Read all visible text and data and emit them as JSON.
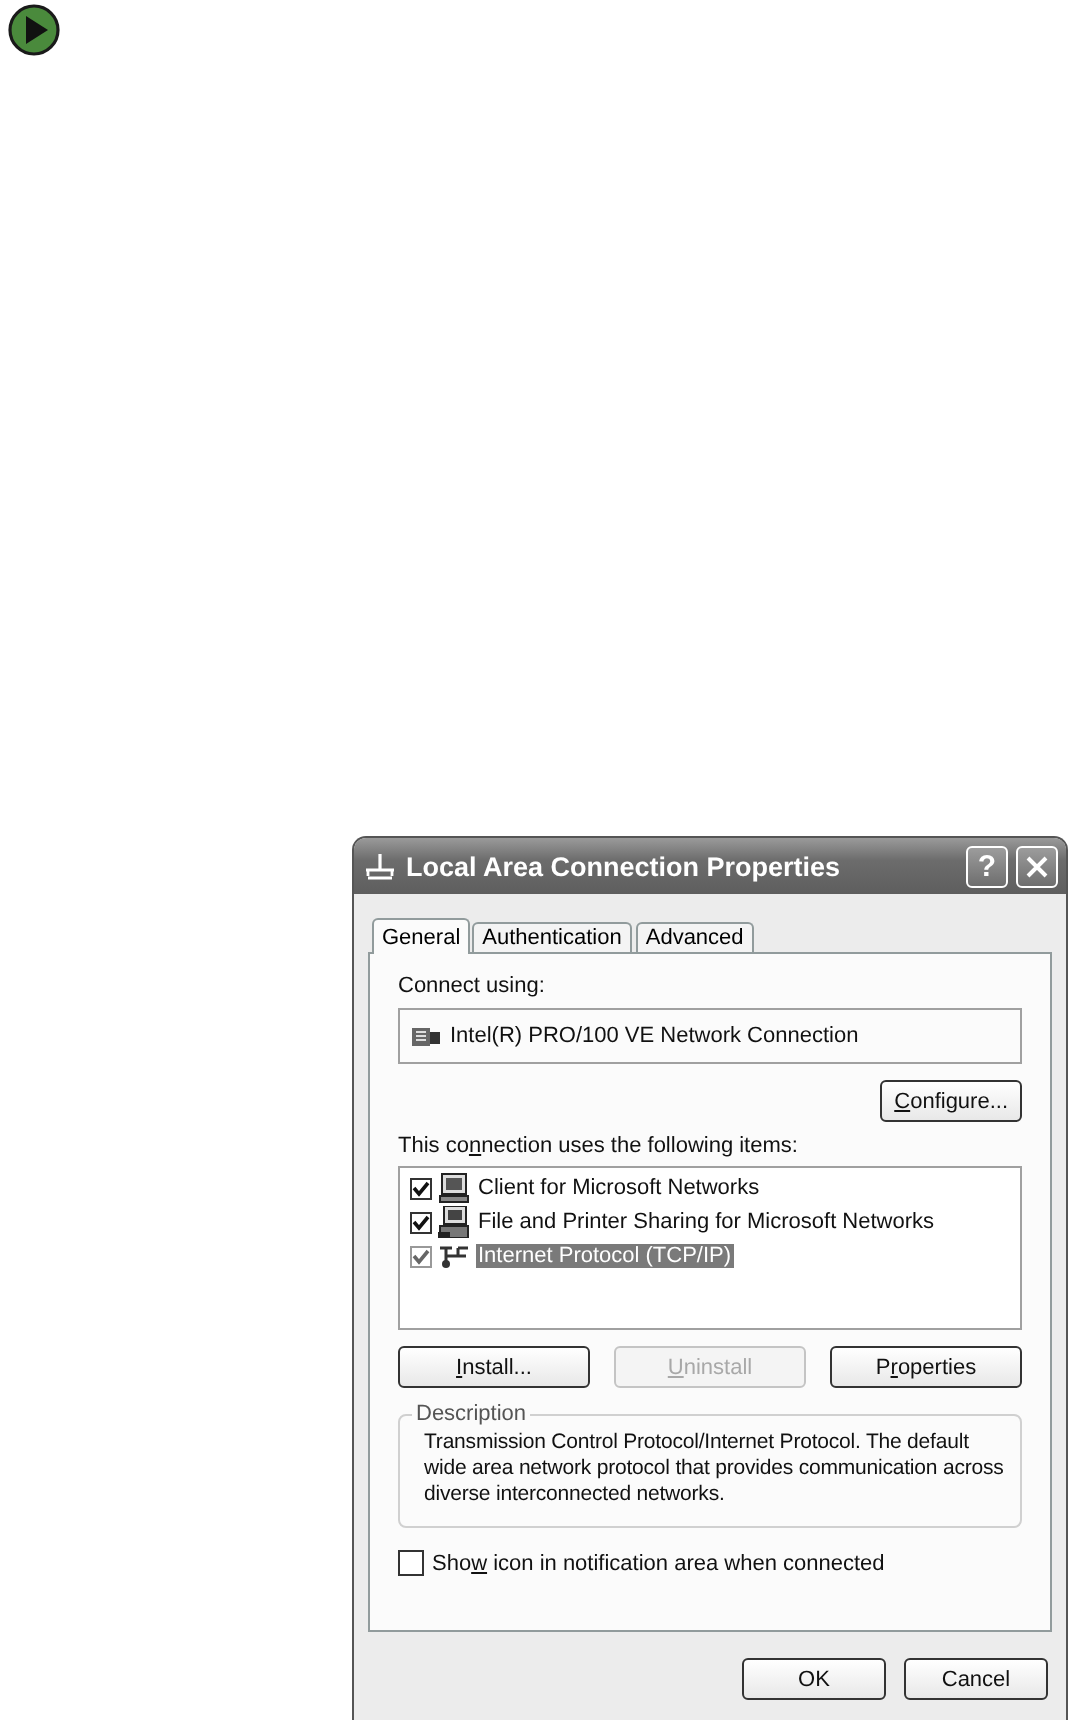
{
  "window": {
    "title": "Local Area Connection Properties"
  },
  "title_buttons": [
    {
      "kind": "help",
      "label": "?"
    },
    {
      "kind": "close"
    }
  ],
  "tabs": [
    {
      "label": "General",
      "selected": true
    },
    {
      "label": "Authentication",
      "selected": false
    },
    {
      "label": "Advanced",
      "selected": false
    }
  ],
  "connect_using": {
    "label": "Connect using:",
    "adapter": "Intel(R) PRO/100 VE Network Connection",
    "button": {
      "label": {
        "key": "C",
        "post": "onfigure..."
      }
    }
  },
  "items_label": {
    "text": {
      "pre": "This co",
      "key": "n",
      "post": "nection uses the following items:"
    }
  },
  "items": [
    {
      "kind": "client",
      "label": "Client for Microsoft Networks",
      "checked": true,
      "selected": false
    },
    {
      "kind": "sharing",
      "label": "File and Printer Sharing for Microsoft Networks",
      "checked": true,
      "selected": false
    },
    {
      "kind": "protocol",
      "label": "Internet Protocol (TCP/IP)",
      "checked": true,
      "selected": true
    }
  ],
  "item_buttons": [
    {
      "label": {
        "key": "I",
        "post": "nstall..."
      },
      "disabled": false
    },
    {
      "label": {
        "key": "U",
        "post": "ninstall"
      },
      "disabled": true
    },
    {
      "label": {
        "pre": "P",
        "key": "r",
        "post": "operties"
      },
      "disabled": false
    }
  ],
  "description": {
    "title": "Description",
    "text": "Transmission Control Protocol/Internet Protocol. The default wide area network protocol that provides communication across diverse interconnected networks."
  },
  "notification_checkbox": {
    "label": {
      "pre": "Sho",
      "key": "w",
      "post": " icon in notification area when connected"
    },
    "checked": false
  },
  "dialog_buttons": [
    {
      "label": "OK"
    },
    {
      "label": "Cancel"
    }
  ]
}
